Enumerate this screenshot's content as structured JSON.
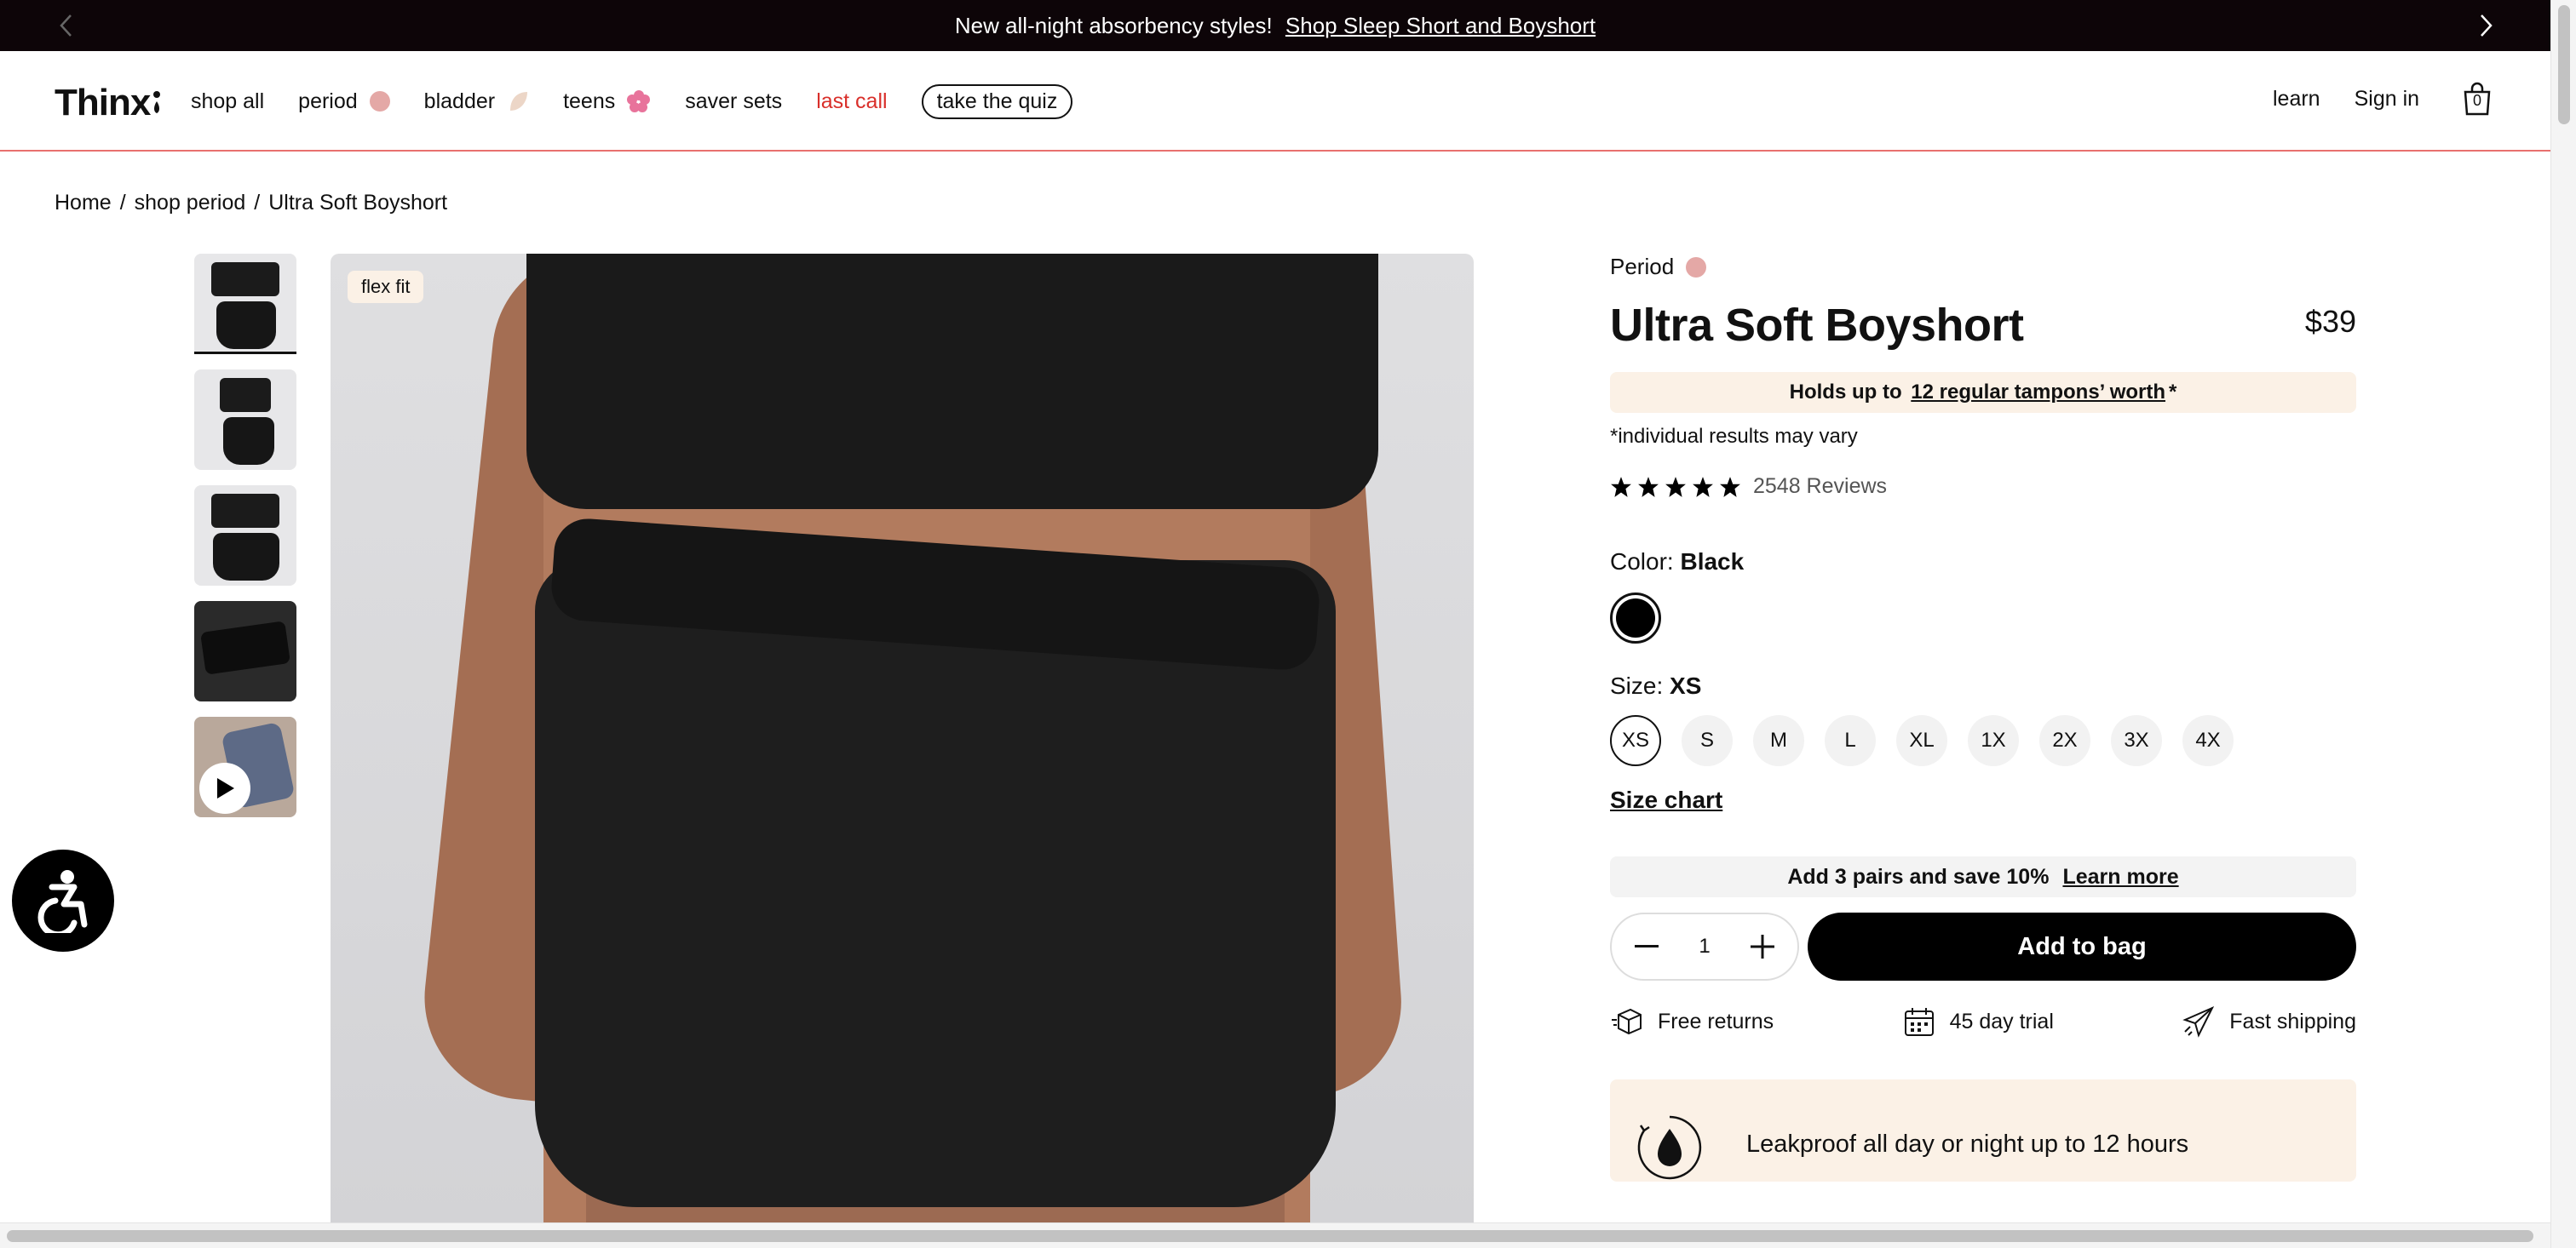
{
  "announcement": {
    "text": "New all-night absorbency styles!",
    "link": "Shop Sleep Short and Boyshort"
  },
  "header": {
    "logo": "Thinx",
    "nav": [
      {
        "label": "shop all"
      },
      {
        "label": "period",
        "dot_color": "#e4a8a6"
      },
      {
        "label": "bladder",
        "dot_color": "#ecd6c7"
      },
      {
        "label": "teens",
        "dot_color": "#e8739b"
      },
      {
        "label": "saver sets"
      },
      {
        "label": "last call",
        "color": "#d92f2a"
      },
      {
        "label": "take the quiz"
      }
    ],
    "learn": "learn",
    "signin": "Sign in",
    "bag_count": "0"
  },
  "breadcrumb": {
    "items": [
      "Home",
      "/",
      "shop period",
      "/",
      "Ultra Soft Boyshort"
    ]
  },
  "gallery": {
    "badge": "flex fit"
  },
  "product": {
    "category": "Period",
    "category_dot_color": "#e4a8a6",
    "title": "Ultra Soft Boyshort",
    "price": "$39",
    "holds_prefix": "Holds up to",
    "holds_link": "12 regular tampons’ worth",
    "holds_suffix": "*",
    "disclaimer": "*individual results may vary",
    "rating_stars": 5,
    "reviews": "2548 Reviews",
    "color_label": "Color:",
    "color_value": "Black",
    "size_label": "Size:",
    "size_value": "XS",
    "sizes": [
      "XS",
      "S",
      "M",
      "L",
      "XL",
      "1X",
      "2X",
      "3X",
      "4X"
    ],
    "size_chart": "Size chart",
    "save_text": "Add 3 pairs and save 10%",
    "save_link": "Learn more",
    "quantity": "1",
    "add_to_bag": "Add to bag",
    "perks": [
      "Free returns",
      "45 day trial",
      "Fast shipping"
    ],
    "leak_text": "Leakproof all day or night up to 12 hours"
  }
}
